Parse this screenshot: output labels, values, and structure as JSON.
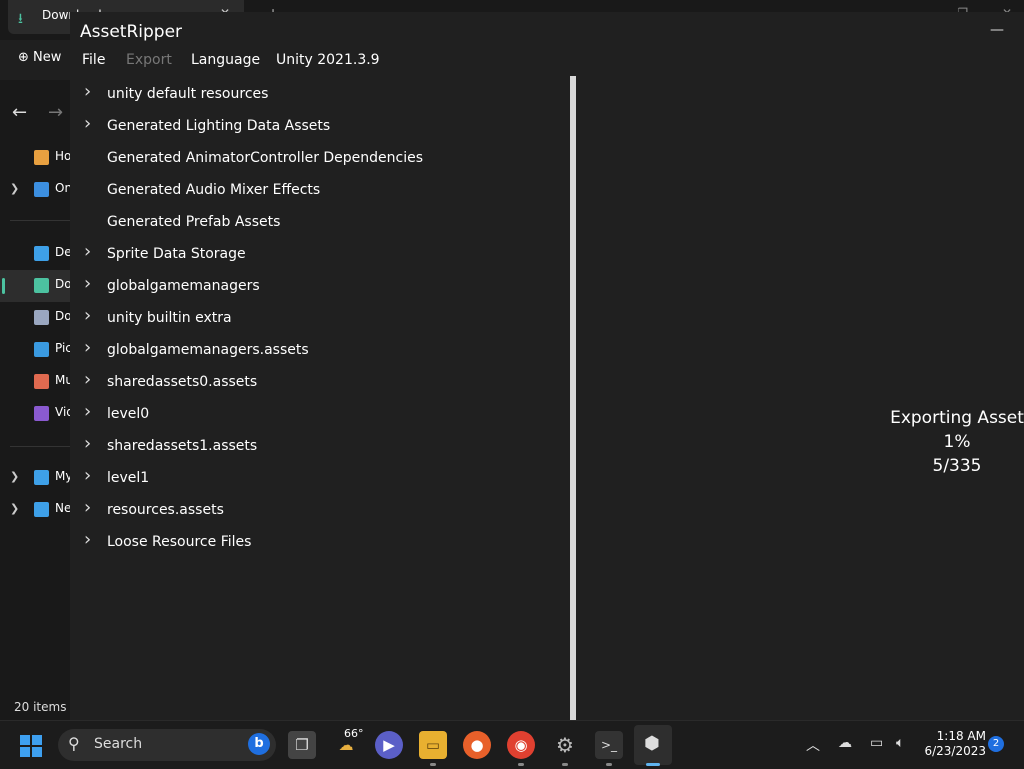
{
  "explorer": {
    "tab_title": "Downloads",
    "new_label": "New",
    "status": "20 items",
    "sidebar": [
      {
        "label": "Home",
        "color": "#e8a040",
        "expand": false
      },
      {
        "label": "OneDrive",
        "color": "#3c8fe0",
        "expand": true
      },
      {
        "label": "Desktop",
        "color": "#3ea0e8",
        "expand": false
      },
      {
        "label": "Downloads",
        "color": "#4cc2a0",
        "expand": false,
        "selected": true
      },
      {
        "label": "Documents",
        "color": "#9aa7c0",
        "expand": false
      },
      {
        "label": "Pictures",
        "color": "#3a9ae0",
        "expand": false
      },
      {
        "label": "Music",
        "color": "#e06a50",
        "expand": false
      },
      {
        "label": "Videos",
        "color": "#8a5ad0",
        "expand": false
      },
      {
        "label": "My PC",
        "color": "#3ea0e8",
        "expand": true
      },
      {
        "label": "Network",
        "color": "#3ea0e8",
        "expand": true
      }
    ]
  },
  "app": {
    "title": "AssetRipper",
    "menu": {
      "file": "File",
      "export": "Export",
      "language": "Language",
      "version": "Unity 2021.3.9"
    },
    "tree": [
      {
        "label": "unity default resources",
        "expandable": true
      },
      {
        "label": "Generated Lighting Data Assets",
        "expandable": true
      },
      {
        "label": "Generated AnimatorController Dependencies",
        "expandable": false
      },
      {
        "label": "Generated Audio Mixer Effects",
        "expandable": false
      },
      {
        "label": "Generated Prefab Assets",
        "expandable": false
      },
      {
        "label": "Sprite Data Storage",
        "expandable": true
      },
      {
        "label": "globalgamemanagers",
        "expandable": true
      },
      {
        "label": "unity builtin extra",
        "expandable": true
      },
      {
        "label": "globalgamemanagers.assets",
        "expandable": true
      },
      {
        "label": "sharedassets0.assets",
        "expandable": true
      },
      {
        "label": "level0",
        "expandable": true
      },
      {
        "label": "sharedassets1.assets",
        "expandable": true
      },
      {
        "label": "level1",
        "expandable": true
      },
      {
        "label": "resources.assets",
        "expandable": true
      },
      {
        "label": "Loose Resource Files",
        "expandable": true
      }
    ],
    "progress": {
      "heading": "Exporting Asset",
      "percent": "1%",
      "count": "5/335"
    }
  },
  "taskbar": {
    "search_placeholder": "Search",
    "weather_temp": "66°",
    "time": "1:18 AM",
    "date": "6/23/2023",
    "notification_count": "2",
    "accent": "#60b4f0"
  }
}
